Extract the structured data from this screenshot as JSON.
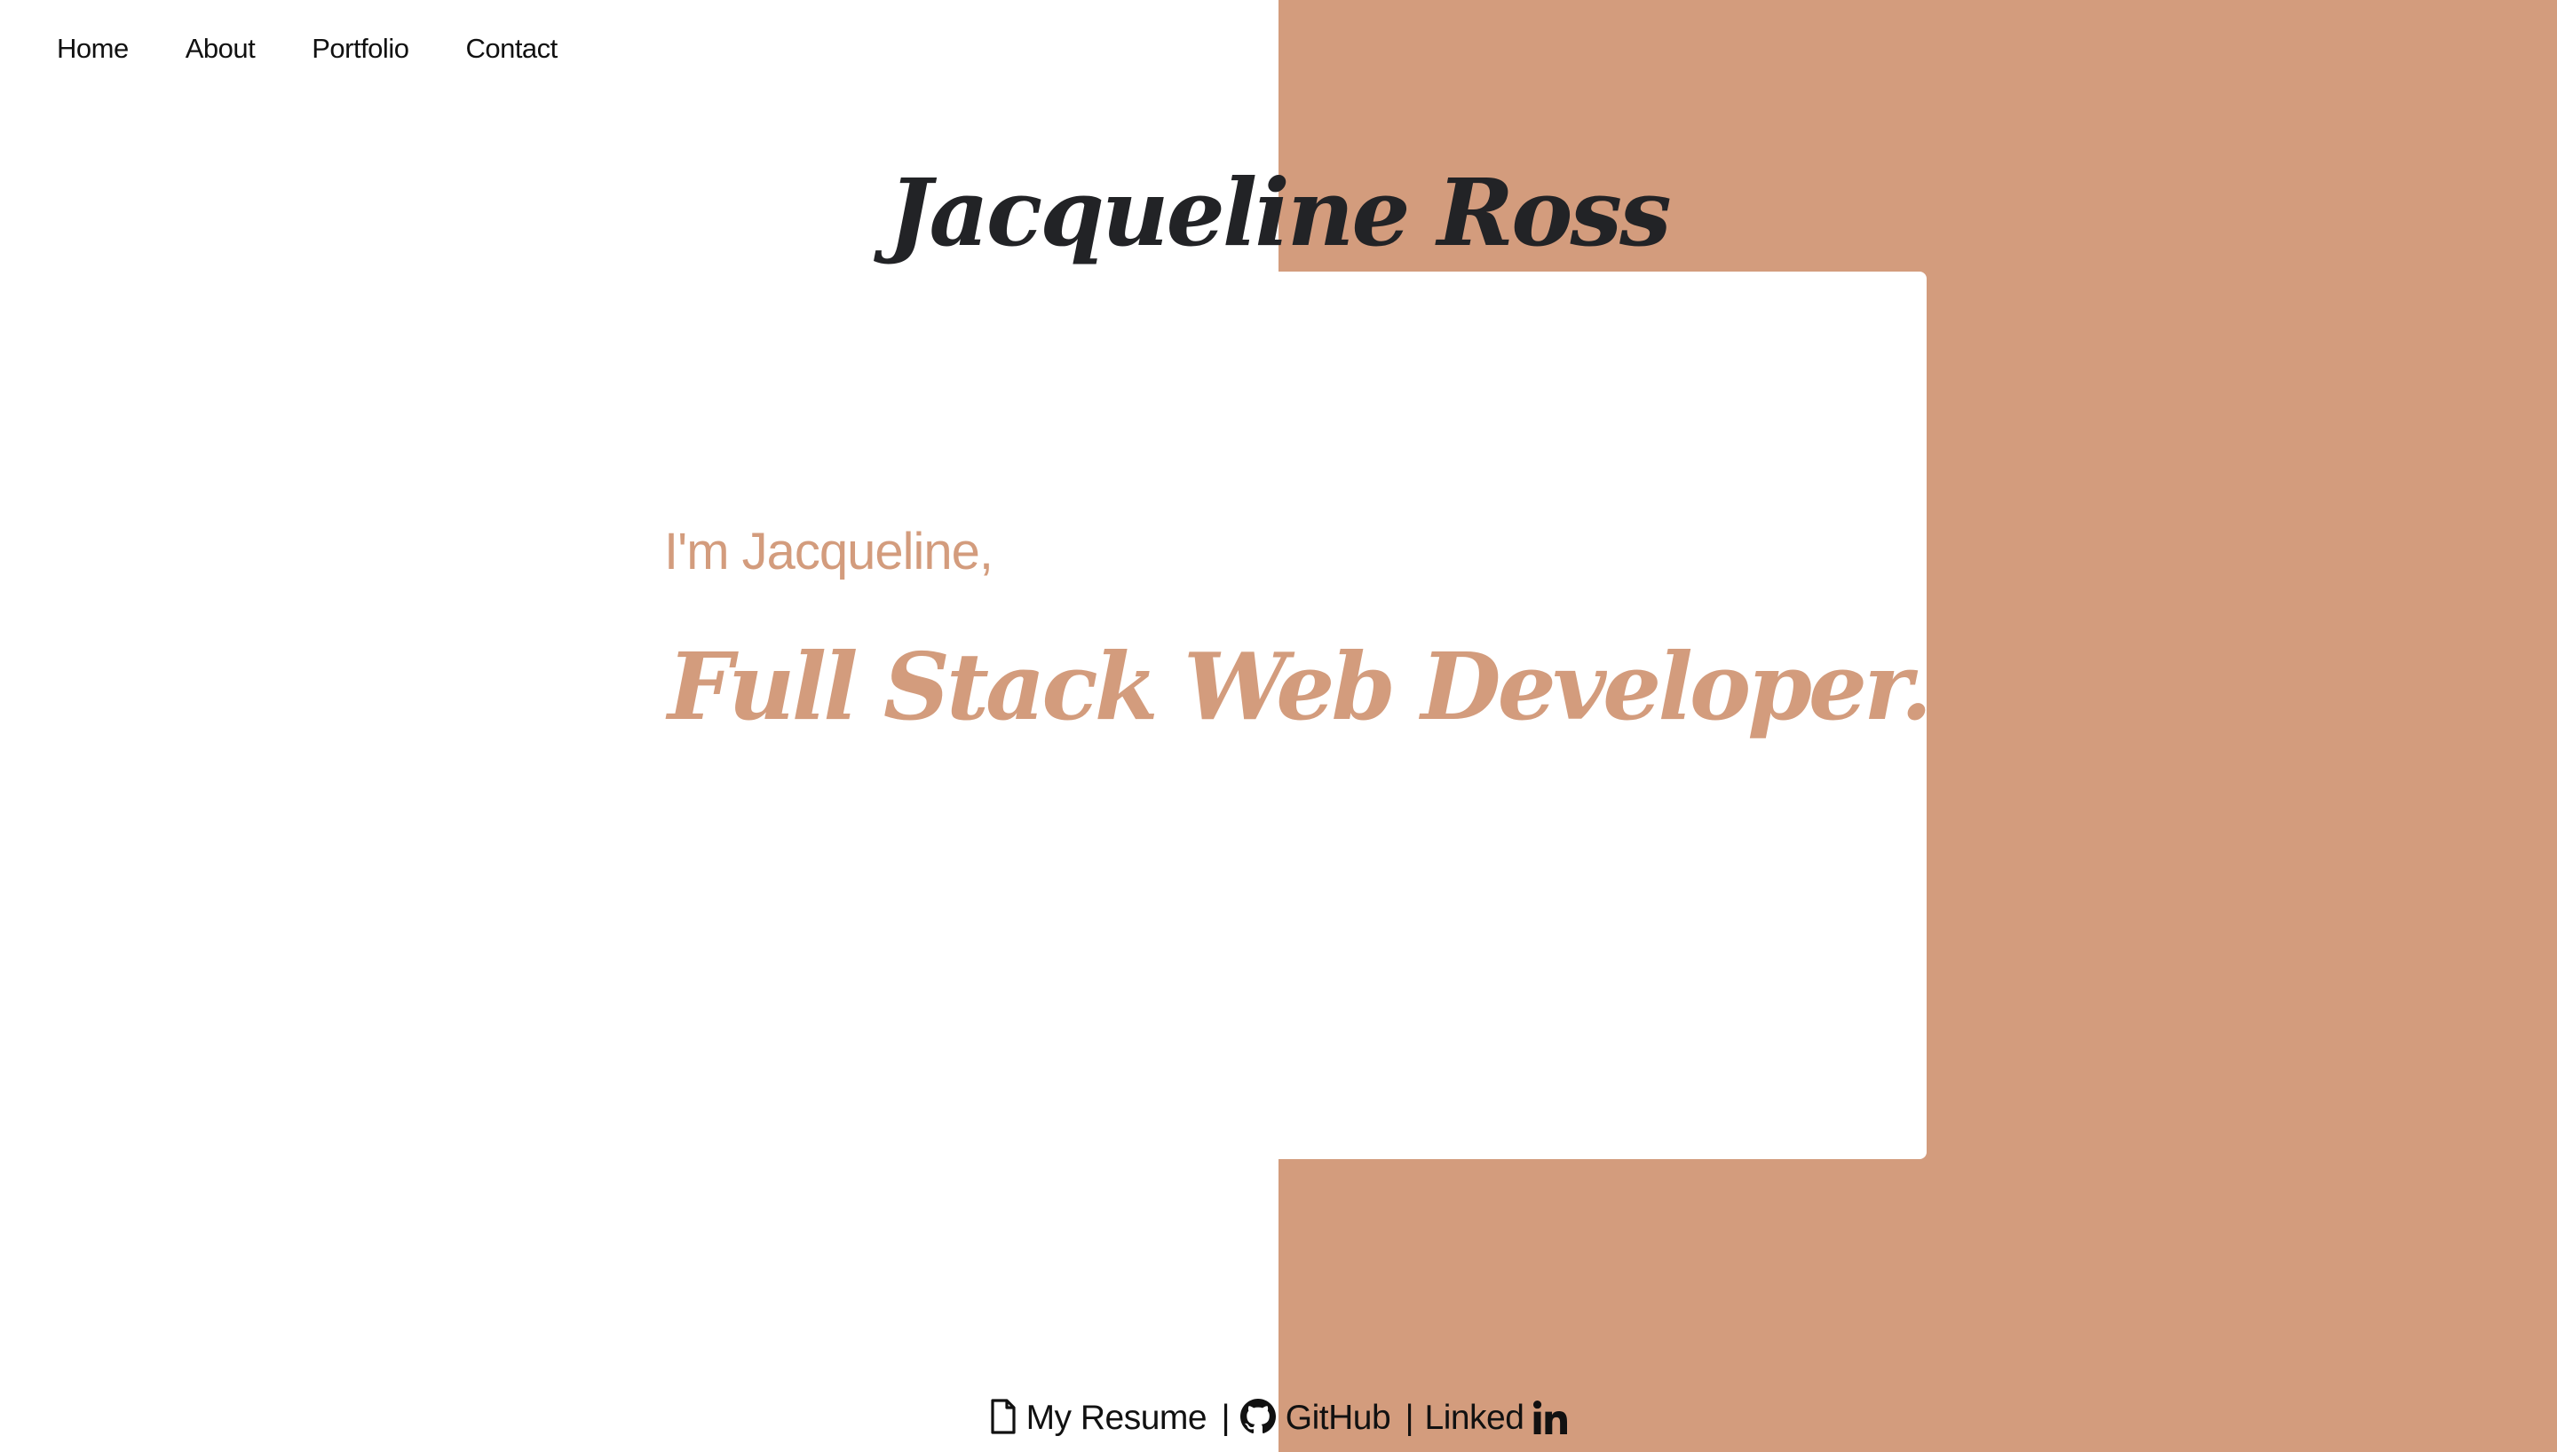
{
  "nav": {
    "items": [
      {
        "label": "Home"
      },
      {
        "label": "About"
      },
      {
        "label": "Portfolio"
      },
      {
        "label": "Contact"
      }
    ]
  },
  "header": {
    "title": "Jacqueline Ross"
  },
  "hero": {
    "greeting": "I'm Jacqueline,",
    "role": "Full Stack Web Developer."
  },
  "footer": {
    "resume_label": "My Resume",
    "github_label": "GitHub",
    "linkedin_label": "Linked",
    "separator": "|",
    "resume_icon": "file-icon",
    "github_icon": "github-icon",
    "linkedin_icon": "linkedin-in-icon"
  },
  "colors": {
    "accent": "#d39c7d",
    "background": "#ffffff",
    "title_text": "#222326",
    "nav_text": "#111111"
  }
}
